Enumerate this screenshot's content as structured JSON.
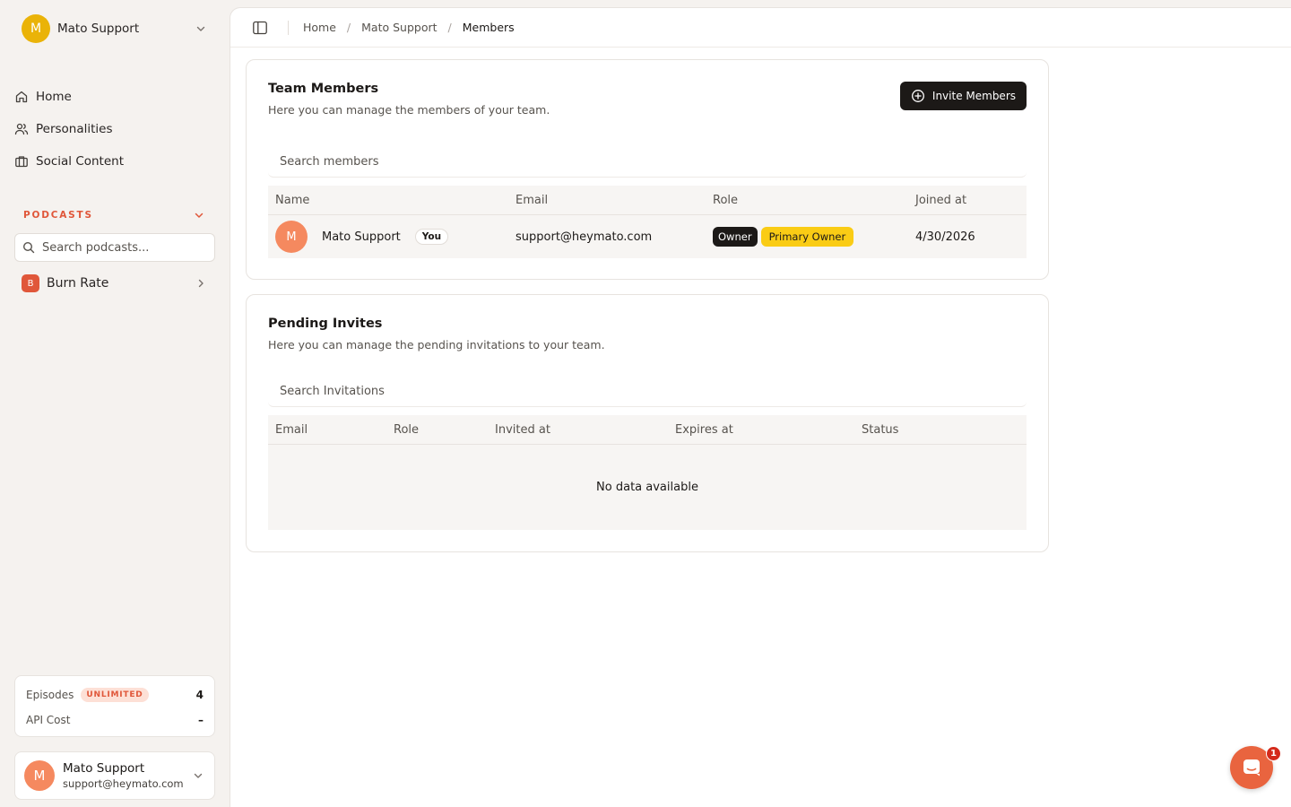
{
  "colors": {
    "accent": "#e0573a",
    "workspace_avatar": "#eab308",
    "user_avatar": "#f5895f",
    "primary_button": "#1c1917",
    "primary_owner_badge": "#facc15",
    "chat_launcher": "#e9643f"
  },
  "sidebar": {
    "workspace": {
      "initial": "M",
      "name": "Mato Support",
      "icon": "chevron-down-icon"
    },
    "nav": [
      {
        "label": "Home",
        "icon": "home-icon"
      },
      {
        "label": "Personalities",
        "icon": "users-icon"
      },
      {
        "label": "Social Content",
        "icon": "briefcase-icon"
      }
    ],
    "podcasts": {
      "section_label": "PODCASTS",
      "search_placeholder": "Search podcasts...",
      "items": [
        {
          "initial": "B",
          "name": "Burn Rate"
        }
      ]
    },
    "usage": {
      "episodes_label": "Episodes",
      "episodes_badge": "UNLIMITED",
      "episodes_value": "4",
      "api_cost_label": "API Cost",
      "api_cost_value": "–"
    },
    "user": {
      "initial": "M",
      "name": "Mato Support",
      "email": "support@heymato.com"
    }
  },
  "header": {
    "breadcrumbs": [
      "Home",
      "Mato Support",
      "Members"
    ],
    "separator": "/"
  },
  "team_members": {
    "title": "Team Members",
    "subtitle": "Here you can manage the members of your team.",
    "invite_button": "Invite Members",
    "search_placeholder": "Search members",
    "columns": [
      "Name",
      "Email",
      "Role",
      "Joined at"
    ],
    "rows": [
      {
        "initial": "M",
        "name": "Mato Support",
        "you_badge": "You",
        "email": "support@heymato.com",
        "role": "Owner",
        "role_badge": "Primary Owner",
        "joined_at": "4/30/2026"
      }
    ]
  },
  "pending_invites": {
    "title": "Pending Invites",
    "subtitle": "Here you can manage the pending invitations to your team.",
    "search_placeholder": "Search Invitations",
    "columns": [
      "Email",
      "Role",
      "Invited at",
      "Expires at",
      "Status"
    ],
    "empty_text": "No data available"
  },
  "chat": {
    "unread_count": "1"
  }
}
